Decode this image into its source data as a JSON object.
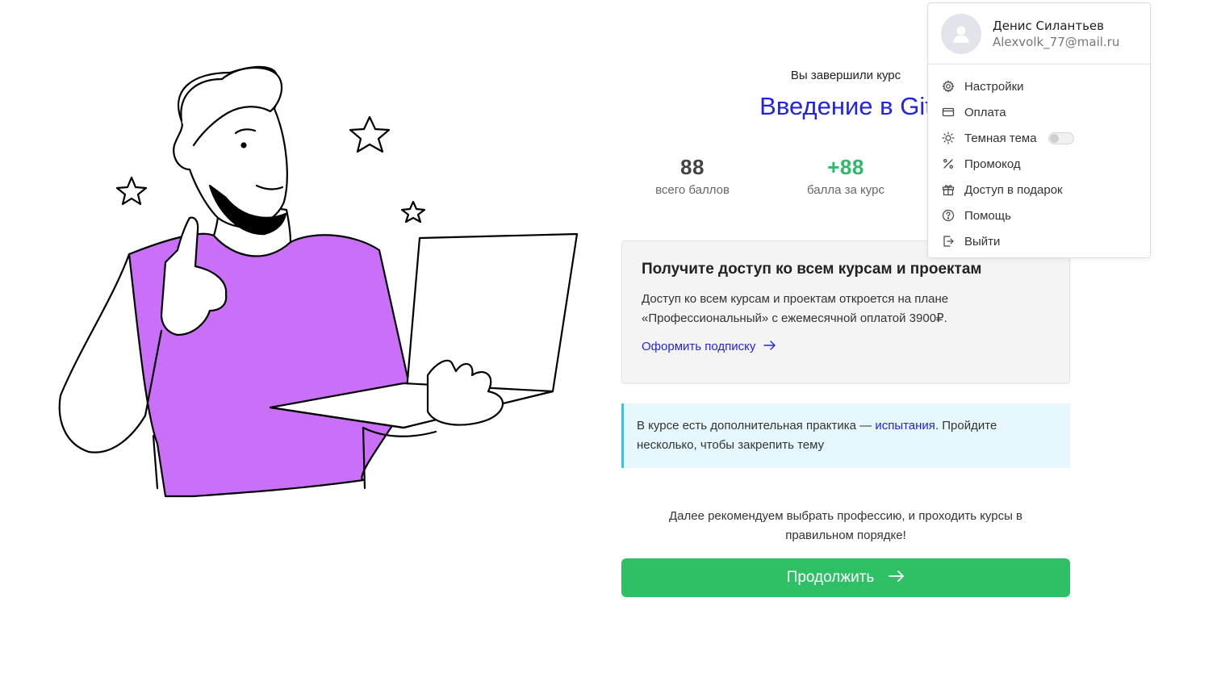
{
  "completion": {
    "finished_label": "Вы завершили курс",
    "course_title": "Введение в Git"
  },
  "stats": [
    {
      "value": "88",
      "label": "всего баллов"
    },
    {
      "value": "+88",
      "label": "балла за курс"
    }
  ],
  "promo": {
    "title": "Получите доступ ко всем курсам и проектам",
    "text": "Доступ ко всем курсам и проектам откроется на плане «Профессиональный» с ежемесячной оплатой 3900₽.",
    "link": "Оформить подписку"
  },
  "info": {
    "before": "В курсе есть дополнительная практика — ",
    "link": "испытания",
    "after": ". Пройдите несколько, чтобы закрепить тему"
  },
  "recommendation": "Далее рекомендуем выбрать профессию, и проходить курсы в правильном порядке!",
  "continue_button": "Продолжить",
  "user_menu": {
    "name": "Денис Силантьев",
    "email": "Alexvolk_77@mail.ru",
    "items": [
      {
        "label": "Настройки",
        "icon": "gear-icon"
      },
      {
        "label": "Оплата",
        "icon": "credit-card-icon"
      },
      {
        "label": "Темная тема",
        "icon": "sun-icon",
        "toggle": false
      },
      {
        "label": "Промокод",
        "icon": "percent-icon"
      },
      {
        "label": "Доступ в подарок",
        "icon": "gift-icon"
      },
      {
        "label": "Помощь",
        "icon": "help-icon"
      },
      {
        "label": "Выйти",
        "icon": "logout-icon"
      }
    ]
  },
  "colors": {
    "accent_link": "#2323e0",
    "success_green": "#2fc066",
    "shirt_purple": "#c96ff8",
    "info_border": "#36c3f0"
  }
}
